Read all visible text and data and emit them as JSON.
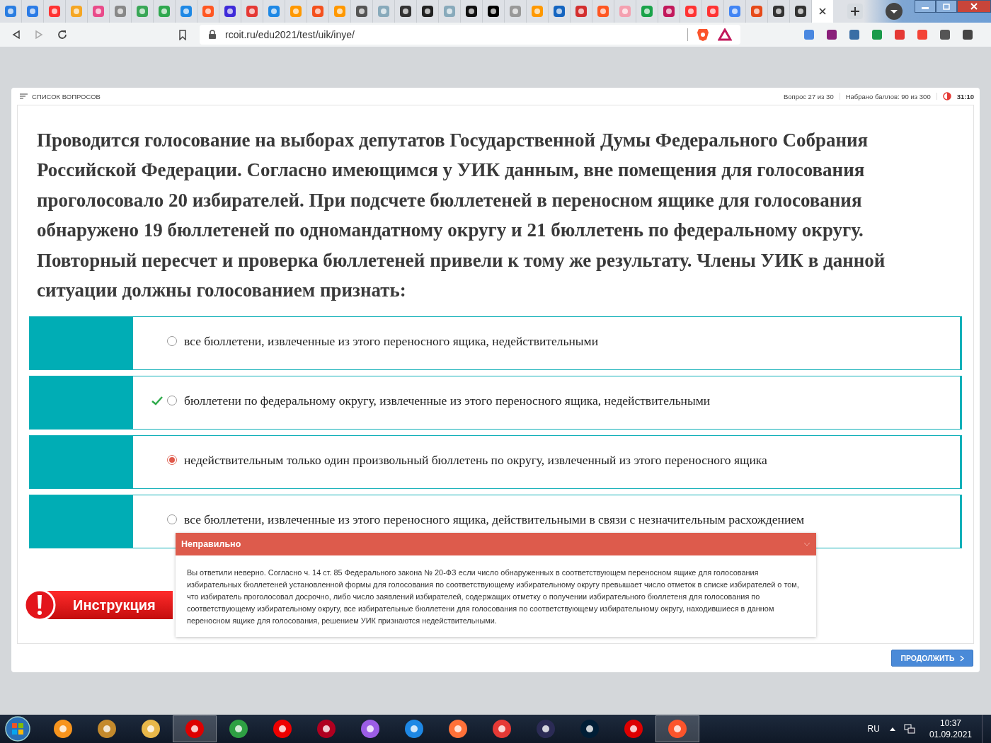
{
  "browser": {
    "url": "rcoit.ru/edu2021/test/uik/inye/"
  },
  "header": {
    "list_label": "СПИСОК ВОПРОСОВ",
    "question_counter": "Вопрос 27 из 30",
    "score": "Набрано баллов: 90 из 300",
    "timer": "31:10"
  },
  "question": "Проводится голосование на выборах депутатов Государственной Думы Федерального Собрания Российской Федерации. Согласно имеющимся у УИК данным, вне помещения для голосования проголосовало 20 избирателей. При подсчете бюллетеней в переносном ящике для голосования обнаружено 19 бюллетеней по одномандатному округу и 21 бюллетень по федеральному округу. Повторный пересчет и проверка бюллетеней привели к тому же результату. Члены УИК в данной ситуации должны голосованием признать:",
  "options": [
    {
      "text": "все бюллетени, извлеченные из этого переносного ящика, недействительными",
      "selected": false,
      "correct": false
    },
    {
      "text": "бюллетени по федеральному округу, извлеченные из этого переносного ящика, недействительными",
      "selected": false,
      "correct": true
    },
    {
      "text": "недействительным только один произвольный бюллетень по округу, извлеченный из этого переносного ящика",
      "selected": true,
      "correct": false
    },
    {
      "text": "все бюллетени, извлеченные из этого переносного ящика, действительными в связи с незначительным расхождением",
      "selected": false,
      "correct": false
    }
  ],
  "feedback": {
    "title": "Неправильно",
    "text": "Вы ответили неверно. Согласно ч. 14 ст. 85 Федерального закона № 20-ФЗ если число обнаруженных в соответствующем переносном ящике для голосования избирательных бюллетеней установленной формы для голосования по соответствующему избирательному округу превышает число отметок в списке избирателей о том, что избиратель проголосовал досрочно, либо число заявлений избирателей, содержащих отметку о получении избирательного бюллетеня для голосования по соответствующему избирательному округу, все избирательные бюллетени для голосования по соответствующему избирательному округу, находившиеся в данном переносном ящике для голосования, решением УИК признаются недействительными."
  },
  "instruction_button": "Инструкция",
  "continue_button": "ПРОДОЛЖИТЬ",
  "taskbar": {
    "language": "RU",
    "time": "10:37",
    "date": "01.09.2021"
  }
}
